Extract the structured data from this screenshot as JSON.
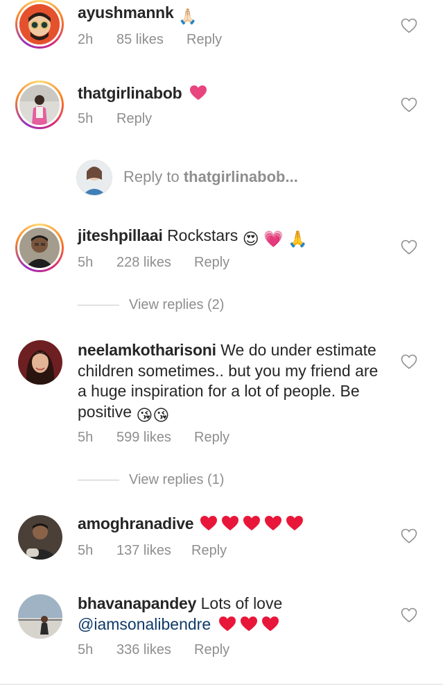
{
  "comments": [
    {
      "username": "ayushmannk",
      "text": "",
      "emojis": [
        "🙏🏻"
      ],
      "time": "2h",
      "likes": "85 likes",
      "reply": "Reply"
    },
    {
      "username": "thatgirlinabob",
      "text": "",
      "emojis": [
        "💘"
      ],
      "time": "5h",
      "likes": "",
      "reply": "Reply"
    },
    {
      "username": "jiteshpillaai",
      "text": "Rockstars",
      "emojis": [
        "😍",
        "💗",
        "🙏"
      ],
      "time": "5h",
      "likes": "228 likes",
      "reply": "Reply",
      "view_replies": "View replies (2)"
    },
    {
      "username": "neelamkotharisoni",
      "text_lines": [
        "We do under estimate",
        "children sometimes.. but you my friend are",
        "a huge inspiration for a lot of people. Be",
        "positive"
      ],
      "emojis": [
        "😘",
        "😘"
      ],
      "time": "5h",
      "likes": "599 likes",
      "reply": "Reply",
      "view_replies": "View replies (1)"
    },
    {
      "username": "amoghranadive",
      "text": "",
      "emojis": [
        "❤️",
        "❤️",
        "❤️",
        "❤️",
        "❤️"
      ],
      "time": "5h",
      "likes": "137 likes",
      "reply": "Reply"
    },
    {
      "username": "bhavanapandey",
      "text": "Lots of love",
      "mention": "@iamsonalibendre",
      "emojis": [
        "❤️",
        "❤️",
        "❤️"
      ],
      "time": "5h",
      "likes": "336 likes",
      "reply": "Reply"
    }
  ],
  "reply_composer": {
    "placeholder_prefix": "Reply to ",
    "placeholder_user": "thatgirlinabob..."
  },
  "colors": {
    "text": "#262626",
    "muted": "#8e8e8e",
    "mention": "#0f3a69",
    "heart_red": "#ed4956"
  }
}
